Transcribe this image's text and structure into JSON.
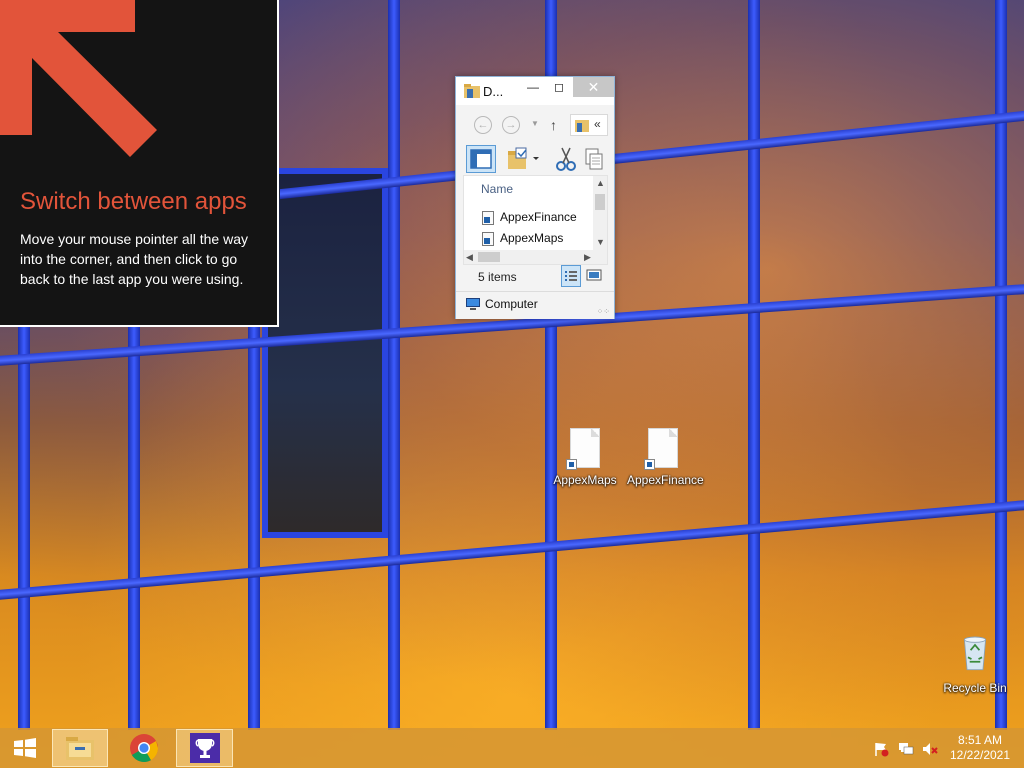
{
  "tip": {
    "title": "Switch between apps",
    "body": "Move your mouse pointer all the way into the corner, and then click to go back to the last app you were using.",
    "arrow_color": "#e2543a"
  },
  "explorer": {
    "title": "D...",
    "address_chevron": "«",
    "column_header": "Name",
    "items": [
      {
        "name": "AppexFinance"
      },
      {
        "name": "AppexMaps"
      }
    ],
    "status": "5 items",
    "nav_pane_item": "Computer"
  },
  "desktop_icons": [
    {
      "label": "AppexMaps"
    },
    {
      "label": "AppexFinance"
    }
  ],
  "recycle_bin": {
    "label": "Recycle Bin"
  },
  "taskbar": {
    "clock_time": "8:51 AM",
    "clock_date": "12/22/2021",
    "items": [
      "start-icon",
      "file-explorer-icon",
      "chrome-icon",
      "trophy-icon"
    ],
    "tray": [
      "action-center-flag-icon",
      "network-icon",
      "volume-muted-icon"
    ],
    "accent_color": "#d6962e"
  }
}
